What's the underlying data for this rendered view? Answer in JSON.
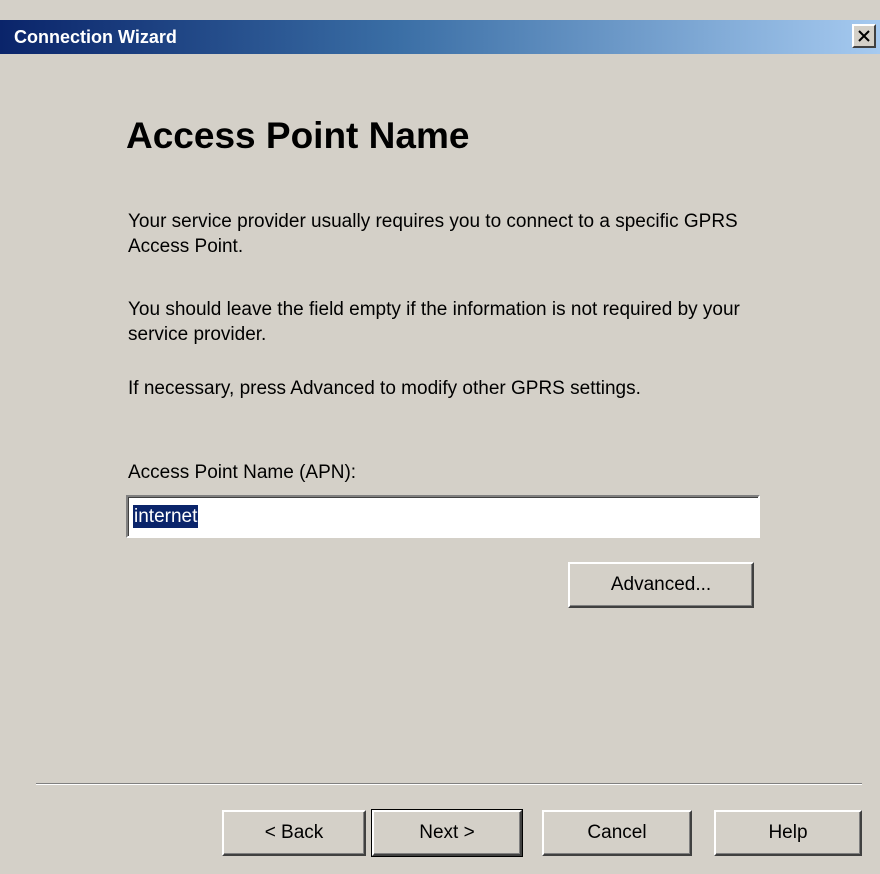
{
  "window": {
    "title": "Connection Wizard",
    "close_icon": "close-icon"
  },
  "page": {
    "heading": "Access Point Name",
    "paragraphs": [
      "Your service provider usually requires you to connect to a specific GPRS Access Point.",
      "You should leave the field empty if the information is not required by your service provider.",
      "If necessary, press Advanced to modify other GPRS settings."
    ]
  },
  "apn": {
    "label": "Access Point Name (APN):",
    "value": "internet"
  },
  "buttons": {
    "advanced": "Advanced...",
    "back": "< Back",
    "next": "Next >",
    "cancel": "Cancel",
    "help": "Help"
  },
  "colors": {
    "titlebar_start": "#0a246a",
    "titlebar_end": "#a6caf0",
    "dialog_bg": "#d4d0c8",
    "selection": "#0a246a"
  }
}
